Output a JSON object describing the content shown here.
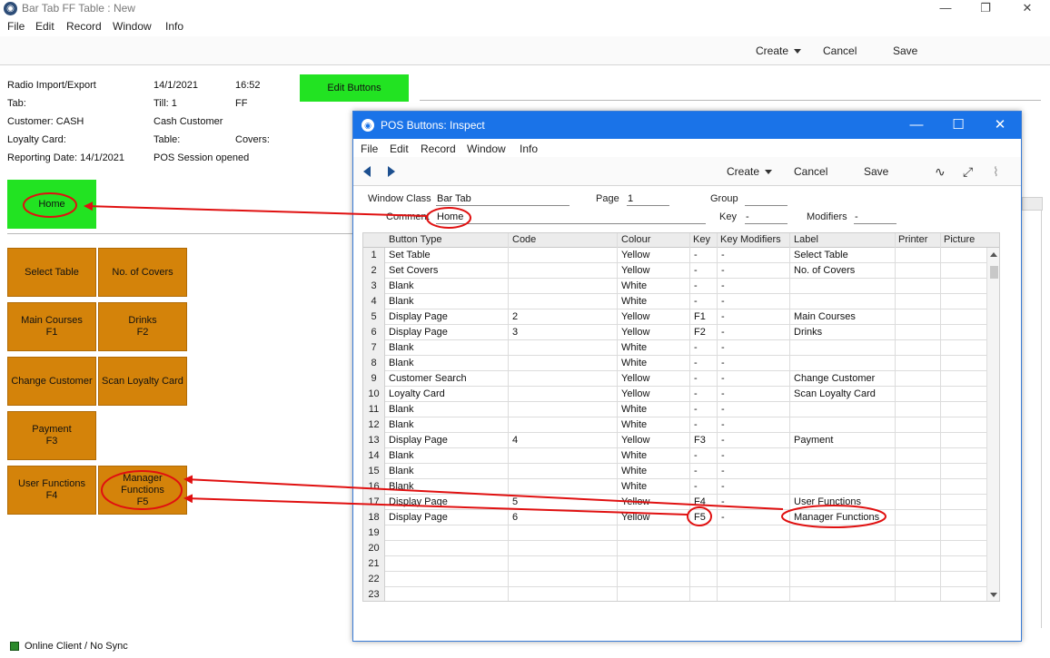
{
  "main_window": {
    "title": "Bar Tab FF Table : New",
    "controls": {
      "minimize": "—",
      "restore": "❐",
      "close": "✕"
    },
    "menu": [
      "File",
      "Edit",
      "Record",
      "Window",
      "Info"
    ],
    "toolbar": {
      "create": "Create",
      "cancel": "Cancel",
      "save": "Save"
    },
    "info": {
      "row1": [
        "Radio Import/Export",
        "14/1/2021",
        "16:52"
      ],
      "row2": [
        "Tab:",
        "Till: 1",
        "FF"
      ],
      "row3": [
        "Customer: CASH",
        "Cash Customer"
      ],
      "row4": [
        "Loyalty Card:",
        "Table:",
        "Covers:"
      ],
      "row5": [
        "Reporting Date: 14/1/2021",
        "POS Session opened"
      ]
    },
    "edit_buttons_label": "Edit Buttons",
    "home_label": "Home",
    "pos_buttons": [
      "Select Table",
      "No. of Covers",
      "Main Courses\nF1",
      "Drinks\nF2",
      "Change Customer",
      "Scan Loyalty Card",
      "Payment\nF3",
      "User Functions\nF4",
      "Manager\nFunctions\nF5"
    ],
    "status": "Online Client / No Sync"
  },
  "inspect_window": {
    "title": "POS Buttons: Inspect",
    "controls": {
      "minimize": "—",
      "maximize": "☐",
      "close": "✕"
    },
    "menu": [
      "File",
      "Edit",
      "Record",
      "Window",
      "Info"
    ],
    "toolbar": {
      "create": "Create",
      "cancel": "Cancel",
      "save": "Save"
    },
    "fields": {
      "window_class_label": "Window Class",
      "window_class": "Bar Tab",
      "page_label": "Page",
      "page": "1",
      "group_label": "Group",
      "group": "",
      "comment_label": "Comment",
      "comment": "Home",
      "key_label": "Key",
      "key": "-",
      "modifiers_label": "Modifiers",
      "modifiers": "-"
    },
    "columns": [
      "Button Type",
      "Code",
      "Colour",
      "Key",
      "Key Modifiers",
      "Label",
      "Printer",
      "Picture"
    ],
    "rows": [
      [
        "1",
        "Set Table",
        "",
        "Yellow",
        "-",
        "-",
        "Select Table"
      ],
      [
        "2",
        "Set Covers",
        "",
        "Yellow",
        "-",
        "-",
        "No. of Covers"
      ],
      [
        "3",
        "Blank",
        "",
        "White",
        "-",
        "-",
        ""
      ],
      [
        "4",
        "Blank",
        "",
        "White",
        "-",
        "-",
        ""
      ],
      [
        "5",
        "Display Page",
        "2",
        "Yellow",
        "F1",
        "-",
        "Main Courses"
      ],
      [
        "6",
        "Display Page",
        "3",
        "Yellow",
        "F2",
        "-",
        "Drinks"
      ],
      [
        "7",
        "Blank",
        "",
        "White",
        "-",
        "-",
        ""
      ],
      [
        "8",
        "Blank",
        "",
        "White",
        "-",
        "-",
        ""
      ],
      [
        "9",
        "Customer Search",
        "",
        "Yellow",
        "-",
        "-",
        "Change Customer"
      ],
      [
        "10",
        "Loyalty Card",
        "",
        "Yellow",
        "-",
        "-",
        "Scan Loyalty Card"
      ],
      [
        "11",
        "Blank",
        "",
        "White",
        "-",
        "-",
        ""
      ],
      [
        "12",
        "Blank",
        "",
        "White",
        "-",
        "-",
        ""
      ],
      [
        "13",
        "Display Page",
        "4",
        "Yellow",
        "F3",
        "-",
        "Payment"
      ],
      [
        "14",
        "Blank",
        "",
        "White",
        "-",
        "-",
        ""
      ],
      [
        "15",
        "Blank",
        "",
        "White",
        "-",
        "-",
        ""
      ],
      [
        "16",
        "Blank",
        "",
        "White",
        "-",
        "-",
        ""
      ],
      [
        "17",
        "Display Page",
        "5",
        "Yellow",
        "F4",
        "-",
        "User Functions"
      ],
      [
        "18",
        "Display Page",
        "6",
        "Yellow",
        "F5",
        "-",
        "Manager Functions"
      ],
      [
        "19",
        "",
        "",
        "",
        "",
        "",
        ""
      ],
      [
        "20",
        "",
        "",
        "",
        "",
        "",
        ""
      ],
      [
        "21",
        "",
        "",
        "",
        "",
        "",
        ""
      ],
      [
        "22",
        "",
        "",
        "",
        "",
        "",
        ""
      ],
      [
        "23",
        "",
        "",
        "",
        "",
        "",
        ""
      ]
    ]
  },
  "colors": {
    "pos_button": "#d4830a",
    "green_button": "#22e322",
    "title_blue": "#1a73e8",
    "annotation_red": "#e01010"
  }
}
